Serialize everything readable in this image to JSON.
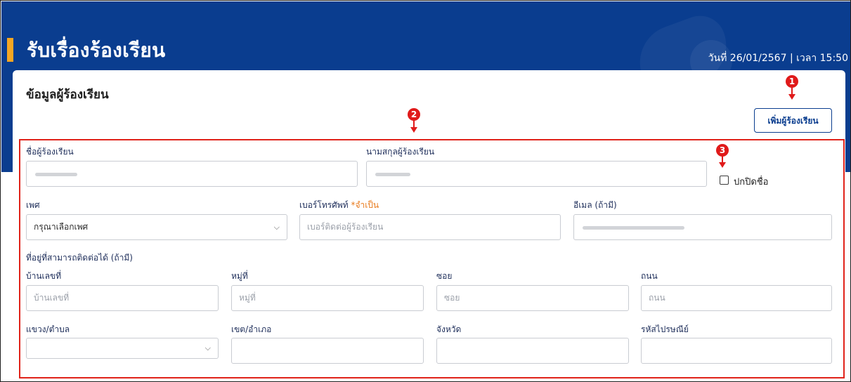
{
  "header": {
    "title": "รับเรื่องร้องเรียน",
    "datetime": "วันที่ 26/01/2567 | เวลา 15:50"
  },
  "section": {
    "title": "ข้อมูลผู้ร้องเรียน",
    "add_button": "เพิ่มผู้ร้องเรียน"
  },
  "markers": [
    "1",
    "2",
    "3"
  ],
  "form": {
    "first_name": {
      "label": "ชื่อผู้ร้องเรียน"
    },
    "last_name": {
      "label": "นามสกุลผู้ร้องเรียน"
    },
    "hide_name": {
      "label": "ปกปิดชื่อ",
      "checked": false
    },
    "gender": {
      "label": "เพศ",
      "value": "กรุณาเลือกเพศ"
    },
    "phone": {
      "label": "เบอร์โทรศัพท์",
      "required": "*จำเป็น",
      "placeholder": "เบอร์ติดต่อผู้ร้องเรียน"
    },
    "email": {
      "label": "อีเมล (ถ้ามี)"
    },
    "address_heading": "ที่อยู่ที่สามารถติดต่อได้ (ถ้ามี)",
    "house_no": {
      "label": "บ้านเลขที่",
      "placeholder": "บ้านเลขที่"
    },
    "moo": {
      "label": "หมู่ที่",
      "placeholder": "หมู่ที่"
    },
    "soi": {
      "label": "ซอย",
      "placeholder": "ซอย"
    },
    "road": {
      "label": "ถนน",
      "placeholder": "ถนน"
    },
    "subdistrict": {
      "label": "แขวง/ตำบล",
      "value": ""
    },
    "district": {
      "label": "เขต/อำเภอ"
    },
    "province": {
      "label": "จังหวัด"
    },
    "postcode": {
      "label": "รหัสไปรษณีย์"
    }
  },
  "colors": {
    "header_bg": "#0a3d8f",
    "accent": "#f5a623",
    "annotation": "#e01a1a",
    "required": "#e8791a"
  }
}
